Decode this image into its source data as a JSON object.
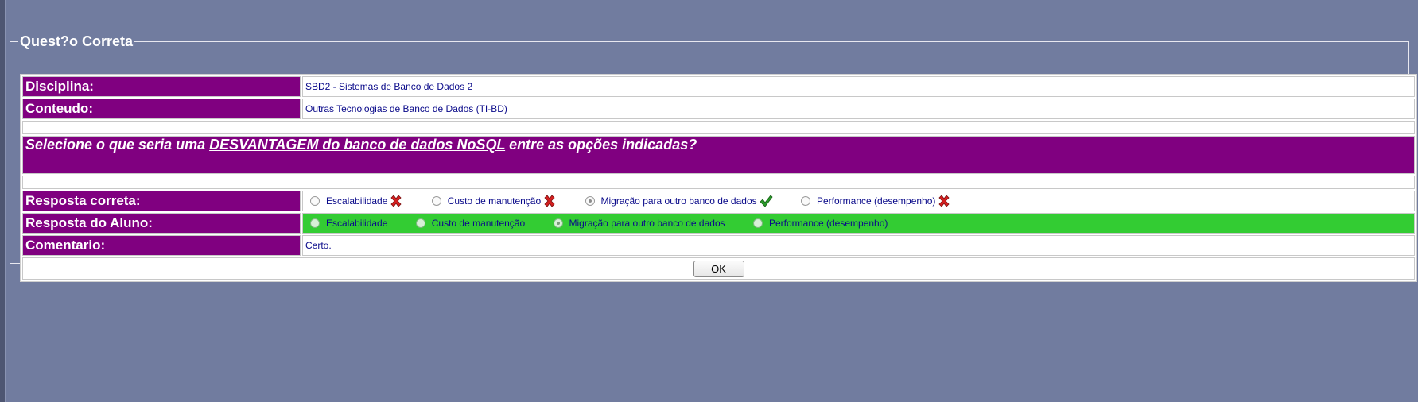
{
  "frame": {
    "legend": "Quest?o Correta"
  },
  "disciplina": {
    "label": "Disciplina:",
    "value": "SBD2 - Sistemas de Banco de Dados 2"
  },
  "conteudo": {
    "label": "Conteudo:",
    "value": "Outras Tecnologias de Banco de Dados (TI-BD)"
  },
  "question": {
    "before": "Selecione o que seria uma ",
    "underlined": "DESVANTAGEM do banco de dados NoSQL",
    "after": " entre as opções indicadas?"
  },
  "correct": {
    "label": "Resposta correta:",
    "options": [
      {
        "text": "Escalabilidade",
        "selected": false,
        "mark": "wrong-x-icon"
      },
      {
        "text": "Custo de manutenção",
        "selected": false,
        "mark": "wrong-x-icon"
      },
      {
        "text": "Migração para outro banco de dados",
        "selected": true,
        "mark": "checkmark-icon"
      },
      {
        "text": "Performance (desempenho)",
        "selected": false,
        "mark": "wrong-x-icon"
      }
    ]
  },
  "student": {
    "label": "Resposta do Aluno:",
    "options": [
      {
        "text": "Escalabilidade",
        "selected": false
      },
      {
        "text": "Custo de manutenção",
        "selected": false
      },
      {
        "text": "Migração para outro banco de dados",
        "selected": true
      },
      {
        "text": "Performance (desempenho)",
        "selected": false
      }
    ]
  },
  "comentario": {
    "label": "Comentario:",
    "value": "Certo."
  },
  "ok_label": "OK",
  "colors": {
    "background": "#717c9f",
    "label_purple": "#800080",
    "student_green": "#33cc33",
    "value_text": "#0a0a8a"
  }
}
